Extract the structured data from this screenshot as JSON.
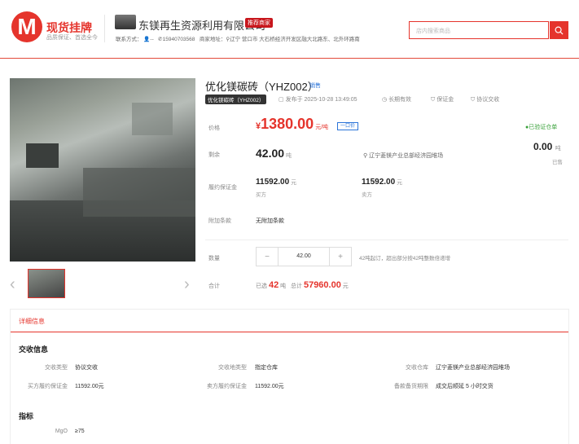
{
  "brand": {
    "logo_letter": "M",
    "title": "现货挂牌",
    "subtitle": "品质保证、首选全今"
  },
  "company": {
    "name": "东镁再生资源利用有限公司",
    "badge": "推荐商家",
    "contact_label": "联系方式：",
    "contact_person": "--",
    "phone": "15940703568",
    "address_label": "商家地址：",
    "address": "辽宁 营口市 大石桥经济开发区融大北路东、北外环路南"
  },
  "search": {
    "placeholder": "店内搜索商品"
  },
  "product": {
    "title": "优化镁碳砖（YHZ002）",
    "status": "销售",
    "code_badge": "优化镁碳砖（YHZ002）",
    "published": "发布于 2025-10-28 13:49:05",
    "validity": "长期有效",
    "deposit_note": "保证金",
    "delivery": "协议交收"
  },
  "price": {
    "label": "价格",
    "currency": "¥",
    "value": "1380.00",
    "unit": "元/吨",
    "chart_button": "一口价",
    "verified": "已验证仓单"
  },
  "remaining": {
    "label": "剩余",
    "value": "42.00",
    "unit": "吨",
    "location": "辽宁菱镁产业总部经济园堆场",
    "sold_value": "0.00",
    "sold_unit": "吨",
    "sold_label": "已售"
  },
  "deposit": {
    "label": "履约保证金",
    "buyer_value": "11592.00",
    "buyer_unit": "元",
    "buyer_label": "买方",
    "seller_value": "11592.00",
    "seller_unit": "元",
    "seller_label": "卖方"
  },
  "extra_terms": {
    "label": "附加条款",
    "value": "无附加条款"
  },
  "quantity": {
    "label": "数量",
    "minus": "−",
    "value": "42.00",
    "plus": "+",
    "hint": "42吨起订，超出部分按42吨整数倍递增"
  },
  "total": {
    "label": "合计",
    "selected_prefix": "已选",
    "selected_qty": "42",
    "selected_unit": "吨",
    "total_prefix": "总计",
    "total_value": "57960.00",
    "total_unit": "元"
  },
  "details": {
    "tab": "详细信息",
    "delivery_title": "交收信息",
    "rows": [
      {
        "k1": "交收类型",
        "v1": "协议交收",
        "k2": "交收地类型",
        "v2": "指定仓库",
        "k3": "交收仓库",
        "v3": "辽宁菱镁产业总部经济园堆场"
      },
      {
        "k1": "买方履约保证金",
        "v1": "11592.00元",
        "k2": "卖方履约保证金",
        "v2": "11592.00元",
        "k3": "备款备货期限",
        "v3": "成交后顺延 5 小时交货"
      }
    ],
    "index_title": "指标",
    "index_rows": [
      {
        "k": "MgO",
        "v": "≥75"
      }
    ]
  },
  "colors": {
    "accent": "#e5342c",
    "link": "#2b74d9",
    "verified": "#39a13a"
  }
}
